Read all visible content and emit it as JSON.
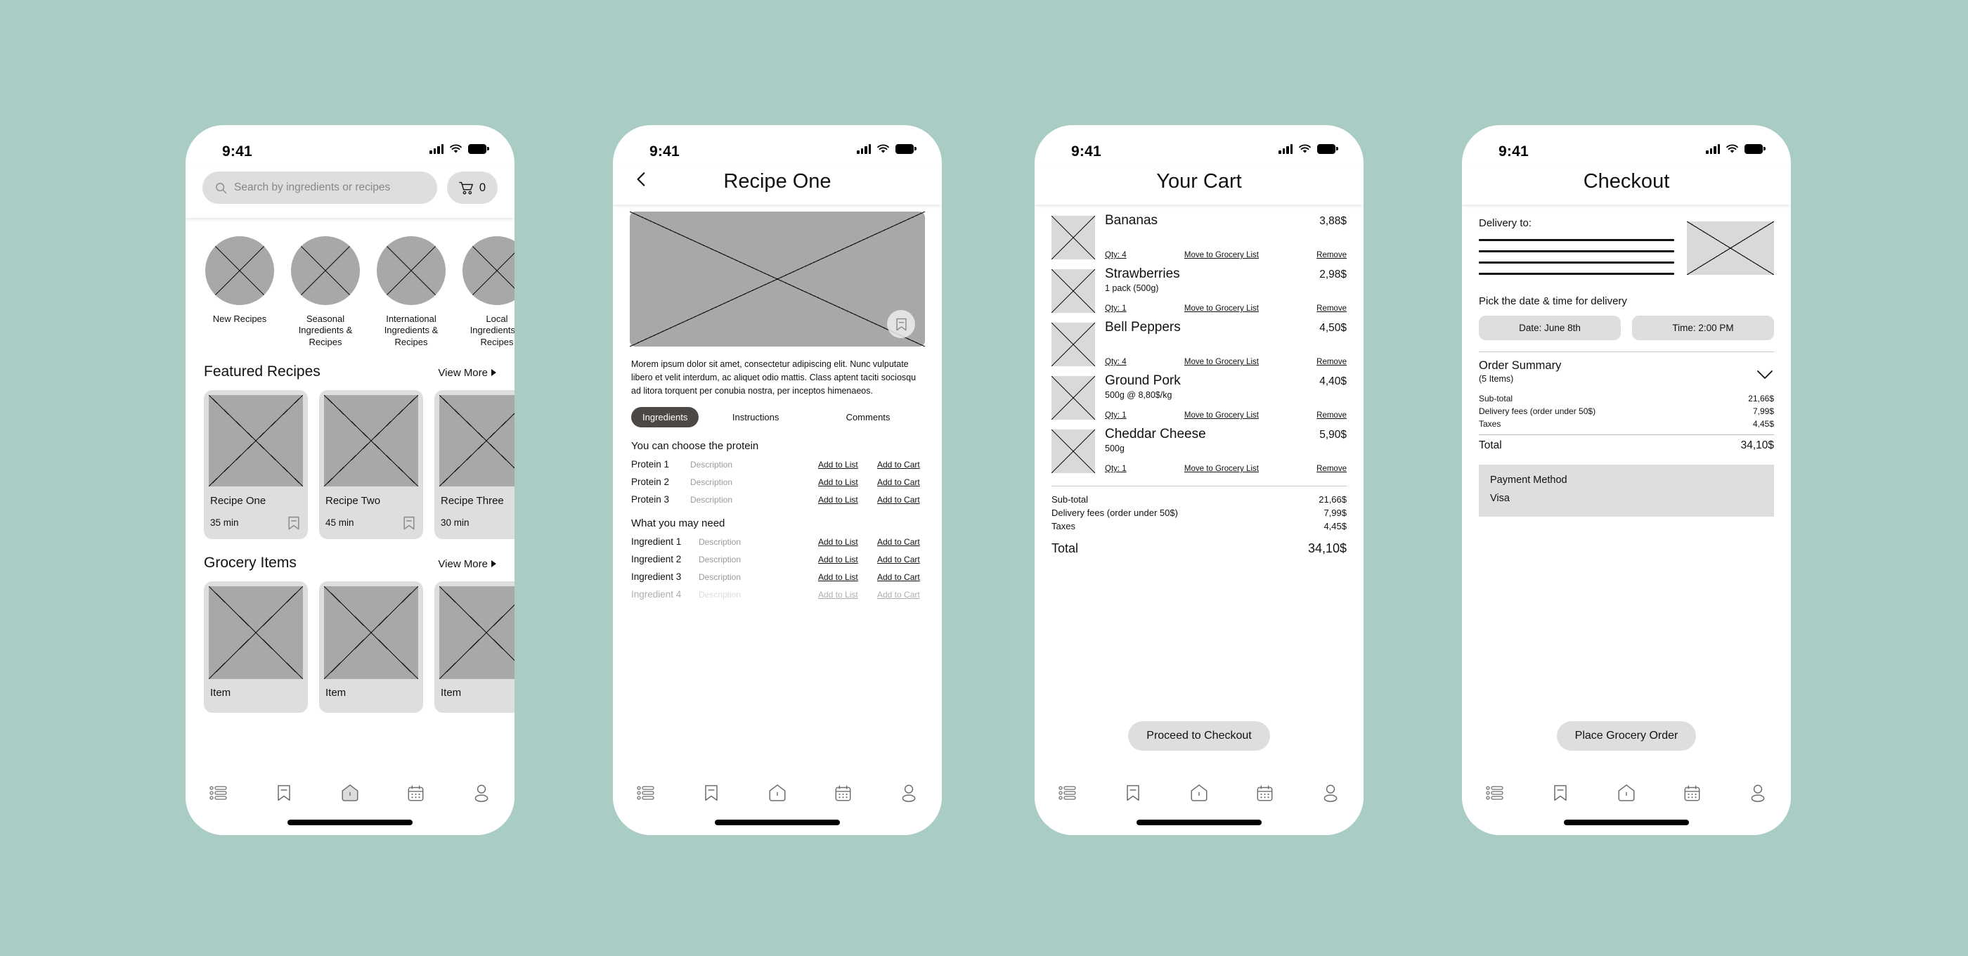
{
  "theme": {
    "background": "#a9ccc4",
    "surface": "#ffffff",
    "muted": "#dedede",
    "placeholder": "#a8a8a8",
    "placeholder_light": "#d9d9d9",
    "chip_dark": "#4b4846"
  },
  "status_bar": {
    "time": "9:41",
    "signal_icon": "cellular-signal-icon",
    "wifi_icon": "wifi-icon",
    "battery_icon": "battery-icon"
  },
  "tab_bar": {
    "items": [
      {
        "name": "list-icon",
        "label": "List"
      },
      {
        "name": "bookmark-icon",
        "label": "Saved"
      },
      {
        "name": "home-icon",
        "label": "Home"
      },
      {
        "name": "calendar-icon",
        "label": "Planner"
      },
      {
        "name": "profile-icon",
        "label": "Profile"
      }
    ]
  },
  "screen_home": {
    "search": {
      "placeholder": "Search by ingredients or recipes",
      "value": "",
      "icon": "search-icon"
    },
    "cart_button": {
      "icon": "cart-icon",
      "count": "0"
    },
    "categories": [
      {
        "label": "New Recipes"
      },
      {
        "label": "Seasonal Ingredients & Recipes"
      },
      {
        "label": "International Ingredients & Recipes"
      },
      {
        "label": "Local Ingredients & Recipes"
      }
    ],
    "featured": {
      "title": "Featured Recipes",
      "view_more": "View More",
      "cards": [
        {
          "title": "Recipe One",
          "time": "35 min",
          "bookmark_icon": "bookmark-minus-icon"
        },
        {
          "title": "Recipe Two",
          "time": "45 min",
          "bookmark_icon": "bookmark-minus-icon"
        },
        {
          "title": "Recipe Three",
          "time": "30 min",
          "bookmark_icon": "bookmark-minus-icon"
        }
      ]
    },
    "grocery": {
      "title": "Grocery Items",
      "view_more": "View More",
      "cards": [
        {
          "title": "Item"
        },
        {
          "title": "Item"
        },
        {
          "title": "Item"
        }
      ]
    }
  },
  "screen_recipe": {
    "title": "Recipe One",
    "back_icon": "chevron-left-icon",
    "hero_bookmark_icon": "bookmark-minus-icon",
    "description": "Morem ipsum dolor sit amet, consectetur adipiscing elit. Nunc vulputate libero et velit interdum, ac aliquet odio mattis. Class aptent taciti sociosqu ad litora torquent per conubia nostra, per inceptos himenaeos.",
    "tabs": [
      {
        "label": "Ingredients",
        "active": true
      },
      {
        "label": "Instructions",
        "active": false
      },
      {
        "label": "Comments",
        "active": false
      }
    ],
    "protein_heading": "You can choose the protein",
    "proteins": [
      {
        "name": "Protein 1",
        "desc": "Description",
        "add_list": "Add to List",
        "add_cart": "Add to Cart"
      },
      {
        "name": "Protein 2",
        "desc": "Description",
        "add_list": "Add to List",
        "add_cart": "Add to Cart"
      },
      {
        "name": "Protein 3",
        "desc": "Description",
        "add_list": "Add to List",
        "add_cart": "Add to Cart"
      }
    ],
    "ingredients_heading": "What you may need",
    "ingredients": [
      {
        "name": "Ingredient 1",
        "desc": "Description",
        "add_list": "Add to List",
        "add_cart": "Add to Cart"
      },
      {
        "name": "Ingredient 2",
        "desc": "Description",
        "add_list": "Add to List",
        "add_cart": "Add to Cart"
      },
      {
        "name": "Ingredient 3",
        "desc": "Description",
        "add_list": "Add to List",
        "add_cart": "Add to Cart"
      },
      {
        "name": "Ingredient 4",
        "desc": "Description",
        "add_list": "Add to List",
        "add_cart": "Add to Cart"
      }
    ]
  },
  "screen_cart": {
    "title": "Your Cart",
    "items": [
      {
        "name": "Bananas",
        "sub": "",
        "price": "3,88$",
        "qty": "Qty: 4",
        "move": "Move to Grocery List",
        "remove": "Remove"
      },
      {
        "name": "Strawberries",
        "sub": "1 pack (500g)",
        "price": "2,98$",
        "qty": "Qty: 1",
        "move": "Move to Grocery List",
        "remove": "Remove"
      },
      {
        "name": "Bell Peppers",
        "sub": "",
        "price": "4,50$",
        "qty": "Qty: 4",
        "move": "Move to Grocery List",
        "remove": "Remove"
      },
      {
        "name": "Ground Pork",
        "sub": "500g @ 8,80$/kg",
        "price": "4,40$",
        "qty": "Qty: 1",
        "move": "Move to Grocery List",
        "remove": "Remove"
      },
      {
        "name": "Cheddar Cheese",
        "sub": "500g",
        "price": "5,90$",
        "qty": "Qty: 1",
        "move": "Move to Grocery List",
        "remove": "Remove"
      }
    ],
    "totals": [
      {
        "label": "Sub-total",
        "value": "21,66$"
      },
      {
        "label": "Delivery fees (order under 50$)",
        "value": "7,99$"
      },
      {
        "label": "Taxes",
        "value": "4,45$"
      }
    ],
    "total": {
      "label": "Total",
      "value": "34,10$"
    },
    "cta": "Proceed to Checkout"
  },
  "screen_checkout": {
    "title": "Checkout",
    "delivery_label": "Delivery to:",
    "pick_label": "Pick the date & time for delivery",
    "date_chip": "Date: June 8th",
    "time_chip": "Time: 2:00 PM",
    "order_summary": {
      "title": "Order Summary",
      "items_count": "(5 Items)",
      "chevron_icon": "chevron-down-icon"
    },
    "totals": [
      {
        "label": "Sub-total",
        "value": "21,66$"
      },
      {
        "label": "Delivery fees (order under 50$)",
        "value": "7,99$"
      },
      {
        "label": "Taxes",
        "value": "4,45$"
      }
    ],
    "total": {
      "label": "Total",
      "value": "34,10$"
    },
    "payment": {
      "title": "Payment Method",
      "value": "Visa"
    },
    "cta": "Place Grocery Order"
  }
}
